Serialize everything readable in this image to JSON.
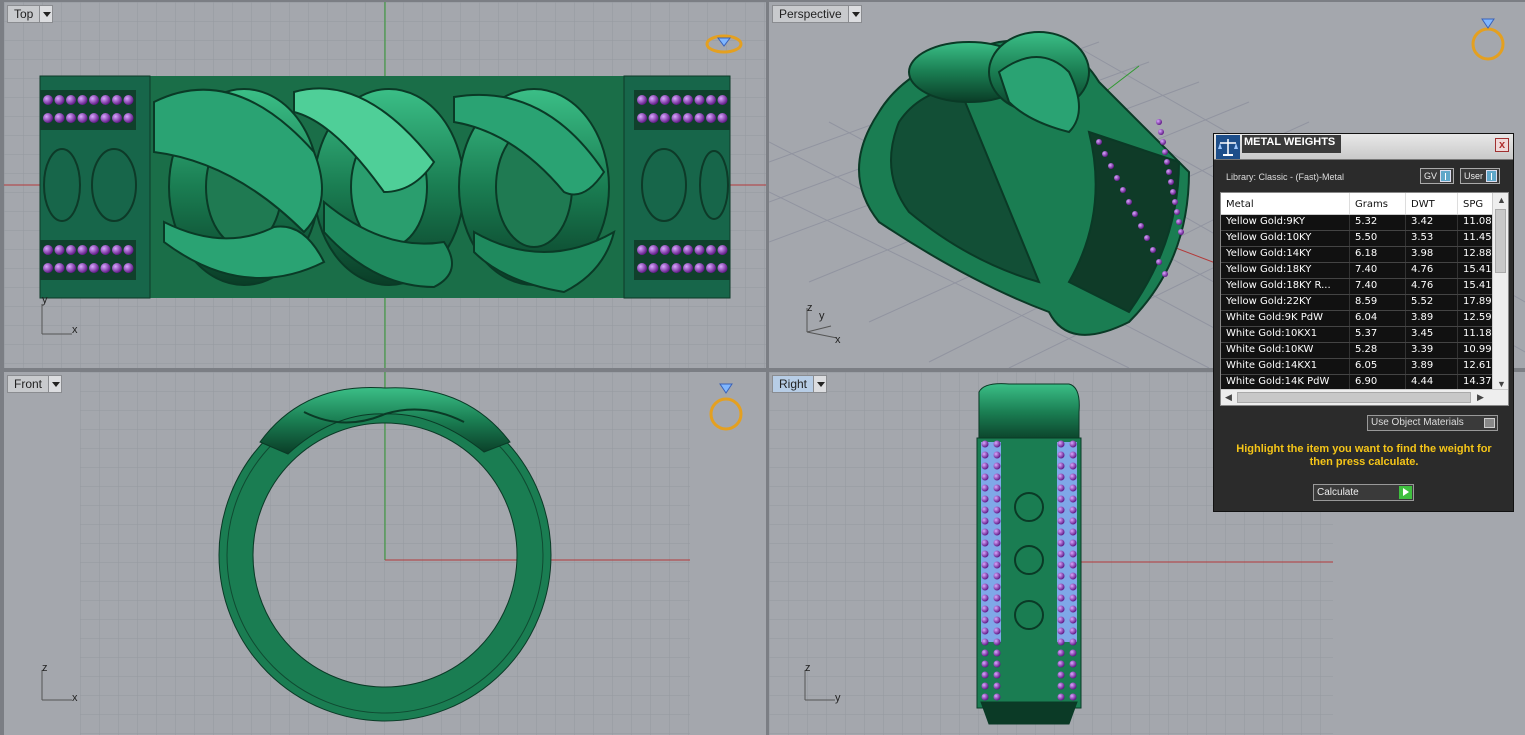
{
  "viewports": {
    "top": {
      "label": "Top",
      "axis_y": "y",
      "axis_x": "x"
    },
    "perspective": {
      "label": "Perspective",
      "axis_z": "z",
      "axis_y": "y",
      "axis_x": "x"
    },
    "front": {
      "label": "Front",
      "axis_z": "z",
      "axis_x": "x"
    },
    "right": {
      "label": "Right",
      "axis_z": "z",
      "axis_y": "y"
    }
  },
  "panel": {
    "title": "METAL WEIGHTS",
    "close": "x",
    "library": "Library: Classic - (Fast)-Metal",
    "toggle_gv": "GV",
    "toggle_user": "User",
    "columns": [
      "Metal",
      "Grams",
      "DWT",
      "SPG"
    ],
    "rows": [
      [
        "Yellow Gold:9KY",
        "5.32",
        "3.42",
        "11.08"
      ],
      [
        "Yellow Gold:10KY",
        "5.50",
        "3.53",
        "11.45"
      ],
      [
        "Yellow Gold:14KY",
        "6.18",
        "3.98",
        "12.88"
      ],
      [
        "Yellow Gold:18KY",
        "7.40",
        "4.76",
        "15.41"
      ],
      [
        "Yellow Gold:18KY R...",
        "7.40",
        "4.76",
        "15.41"
      ],
      [
        "Yellow Gold:22KY",
        "8.59",
        "5.52",
        "17.89"
      ],
      [
        "White Gold:9K PdW",
        "6.04",
        "3.89",
        "12.59"
      ],
      [
        "White Gold:10KX1",
        "5.37",
        "3.45",
        "11.18"
      ],
      [
        "White Gold:10KW",
        "5.28",
        "3.39",
        "10.99"
      ],
      [
        "White Gold:14KX1",
        "6.05",
        "3.89",
        "12.61"
      ],
      [
        "White Gold:14K PdW",
        "6.90",
        "4.44",
        "14.37"
      ]
    ],
    "use_object_materials": "Use Object Materials",
    "hint": "Highlight the item you want to find the weight for then press calculate.",
    "calculate": "Calculate"
  },
  "colors": {
    "ring_green": "#1e8a5a",
    "gem_purple": "#8a2ab8",
    "hint_yellow": "#f5c518",
    "axis_red": "#b33a3a",
    "axis_green": "#2f9a2f"
  }
}
